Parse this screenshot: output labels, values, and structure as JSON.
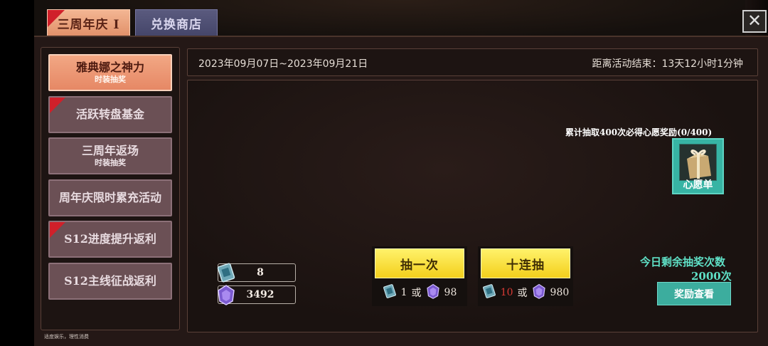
{
  "tabs": [
    {
      "label": "三周年庆 I",
      "active": true
    },
    {
      "label": "兑换商店",
      "active": false
    }
  ],
  "close_icon": "close-icon",
  "sidebar": {
    "items": [
      {
        "main": "雅典娜之神力",
        "sub": "时装抽奖",
        "active": true,
        "badge": false
      },
      {
        "main": "活跃转盘基金",
        "sub": "",
        "active": false,
        "badge": true
      },
      {
        "main": "三周年返场",
        "sub": "时装抽奖",
        "active": false,
        "badge": false
      },
      {
        "main": "周年庆限时累充活动",
        "sub": "",
        "active": false,
        "badge": false
      },
      {
        "main": "S12进度提升返利",
        "sub": "",
        "active": false,
        "badge": true
      },
      {
        "main": "S12主线征战返利",
        "sub": "",
        "active": false,
        "badge": false
      }
    ],
    "footer_note": "适度娱乐，理性消费"
  },
  "event": {
    "date_range": "2023年09月07日~2023年09月21日",
    "countdown": "距离活动结束：13天12小时1分钟"
  },
  "accumulate": {
    "text": "累计抽取400次必得心愿奖励(0/400)",
    "wishlist_label": "心愿单"
  },
  "resources": {
    "tickets": "8",
    "crystals": "3492"
  },
  "draw": {
    "single": {
      "label": "抽一次",
      "ticket_cost": "1",
      "or": "或",
      "crystal_cost": "98"
    },
    "ten": {
      "label": "十连抽",
      "ticket_cost": "10",
      "or": "或",
      "crystal_cost": "980"
    }
  },
  "remaining": {
    "label": "今日剩余抽奖次数",
    "count": "2000次"
  },
  "rewards_button": "奖励查看",
  "colors": {
    "accent_orange": "#e8916b",
    "teal": "#3cad9e",
    "gold": "#f3cf1c",
    "badge_red": "#d0202a"
  }
}
